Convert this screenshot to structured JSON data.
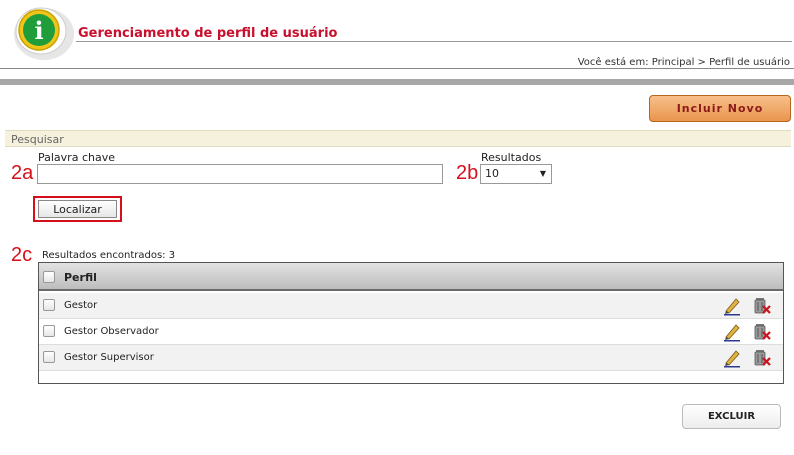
{
  "header": {
    "title": "Gerenciamento de perfil de usuário",
    "breadcrumb": "Você está em: Principal > Perfil de usuário",
    "logo_glyph": "i"
  },
  "actions": {
    "new_label": "Incluir Novo",
    "delete_label": "EXCLUIR"
  },
  "search": {
    "section_title": "Pesquisar",
    "keyword_label": "Palavra chave",
    "keyword_value": "",
    "results_label": "Resultados",
    "results_value": "10",
    "find_label": "Localizar"
  },
  "annotations": {
    "a": "2a",
    "b": "2b",
    "c": "2c"
  },
  "results": {
    "count_text": "Resultados encontrados: 3",
    "column_header": "Perfil",
    "rows": [
      {
        "name": "Gestor"
      },
      {
        "name": "Gestor Observador"
      },
      {
        "name": "Gestor Supervisor"
      }
    ]
  },
  "icons": {
    "edit": "pencil-icon",
    "delete": "trash-delete-icon",
    "dropdown": "caret-down-icon"
  },
  "colors": {
    "title": "#c8102e",
    "annotation": "#d6101a",
    "new_button": "#e9954e",
    "section_bg": "#f5f1dc"
  }
}
